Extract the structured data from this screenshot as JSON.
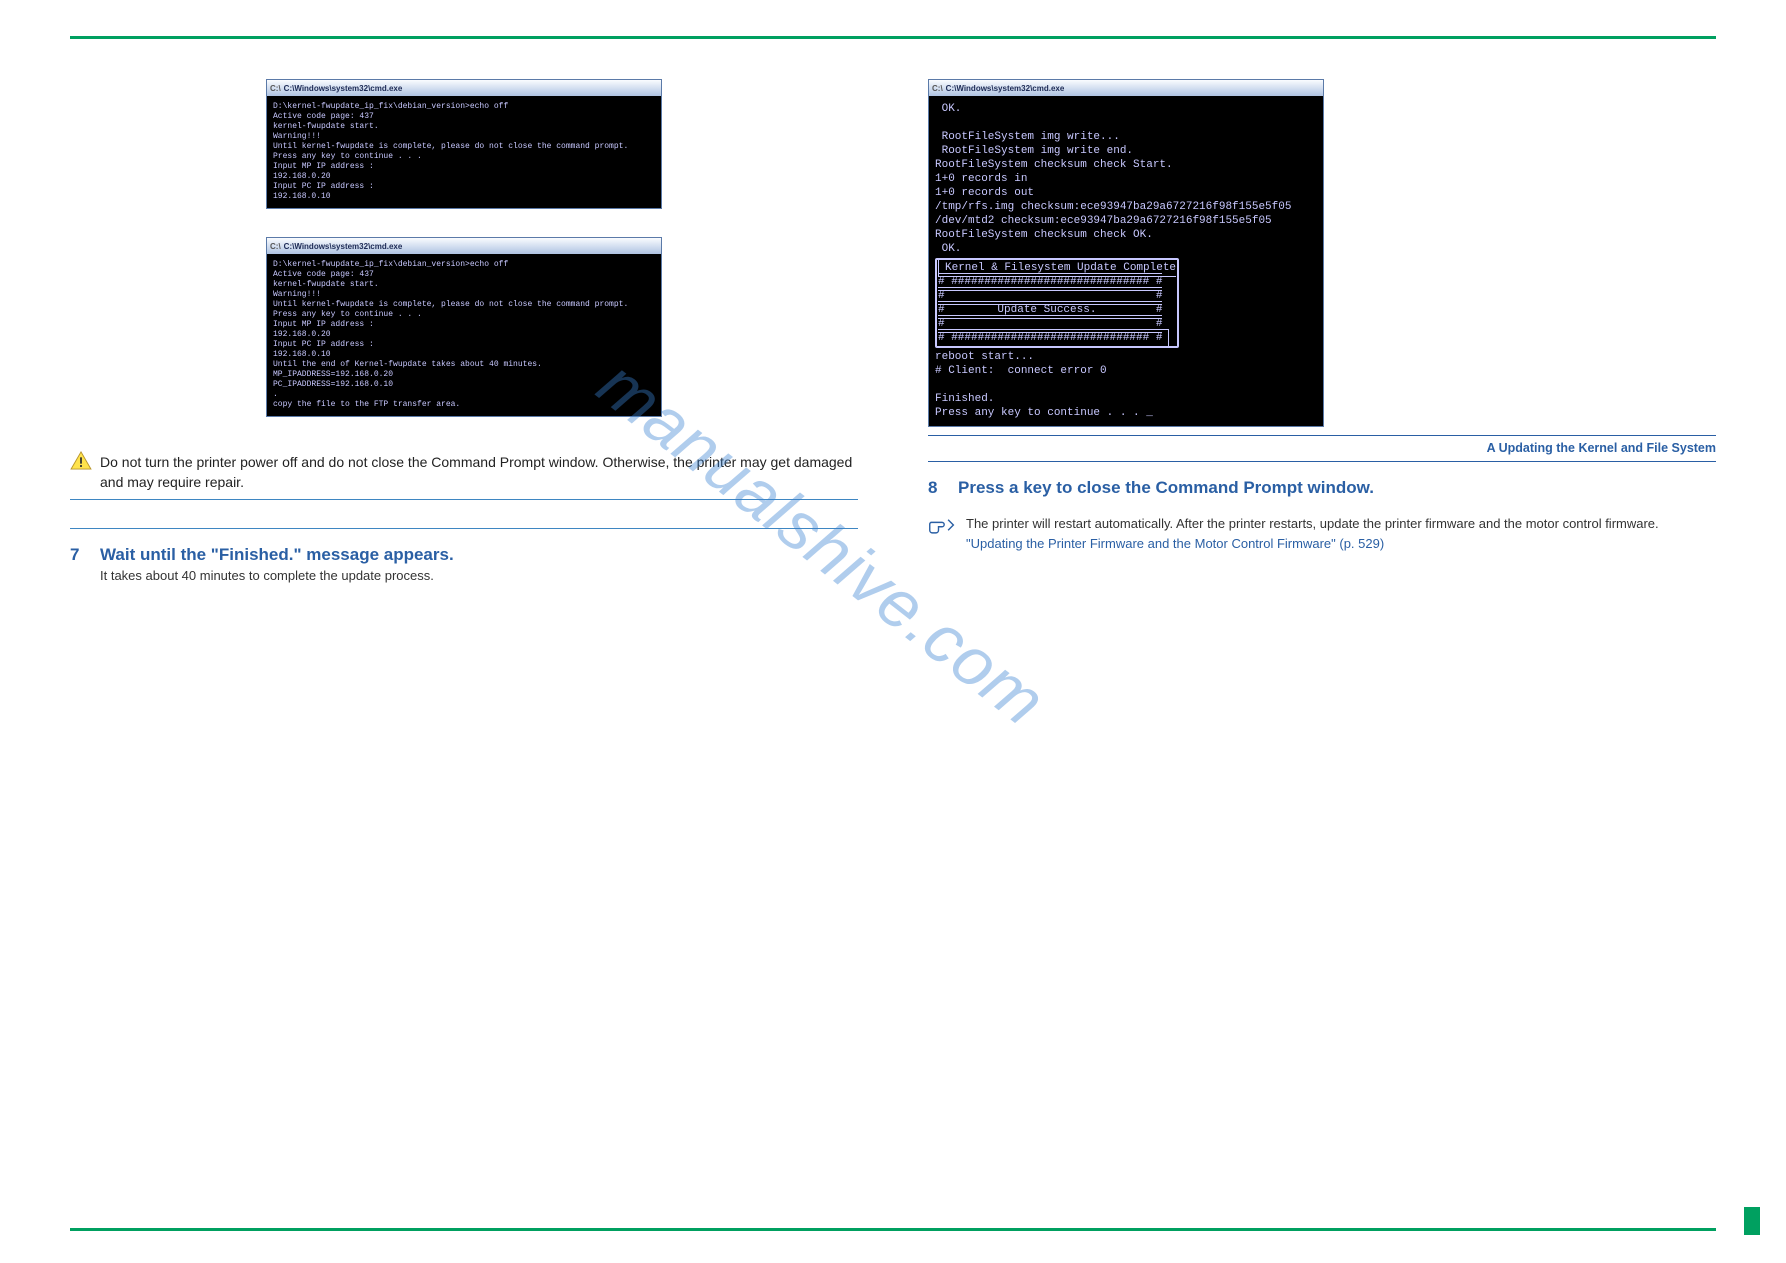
{
  "watermark": "manualshive.com",
  "cmd_title_prefix": "C:\\",
  "cmd_title": "C:\\Windows\\system32\\cmd.exe",
  "cmd1_body": "D:\\kernel-fwupdate_ip_fix\\debian_version>echo off\nActive code page: 437\nkernel-fwupdate start.\nWarning!!!\nUntil kernel-fwupdate is complete, please do not close the command prompt.\nPress any key to continue . . .\nInput MP IP address :\n192.168.0.20\nInput PC IP address :\n192.168.0.10",
  "cmd2_body": "D:\\kernel-fwupdate_ip_fix\\debian_version>echo off\nActive code page: 437\nkernel-fwupdate start.\nWarning!!!\nUntil kernel-fwupdate is complete, please do not close the command prompt.\nPress any key to continue . . .\nInput MP IP address :\n192.168.0.20\nInput PC IP address :\n192.168.0.10\nUntil the end of Kernel-fwupdate takes about 40 minutes.\nMP_IPADDRESS=192.168.0.20\nPC_IPADDRESS=192.168.0.10\n.\ncopy the file to the FTP transfer area.",
  "cmd3_body_pre": " OK.\n\n RootFileSystem img write...\n RootFileSystem img write end.\nRootFileSystem checksum check Start.\n1+0 records in\n1+0 records out\n/tmp/rfs.img checksum:ece93947ba29a6727216f98f155e5f05\n/dev/mtd2 checksum:ece93947ba29a6727216f98f155e5f05\nRootFileSystem checksum check OK.\n OK.",
  "cmd3_box1": "Kernel & Filesystem Update Complete",
  "cmd3_box2": "# ############################## #\n#                                #\n#        Update Success.         #\n#                                #\n# ############################## #",
  "cmd3_body_post": "\nreboot start...\n# Client:  connect error 0\n\nFinished.\nPress any key to continue . . . _",
  "warn_text": "Do not turn the printer power off and do not close the Command Prompt window. Otherwise, the printer may get damaged and may require repair.",
  "step7_num": "7",
  "step7_text": "Wait until the \"Finished.\" message appears.",
  "step7_sub": "It takes about 40 minutes to complete the update process.",
  "stepbar_title": "A  Updating the Kernel and File System",
  "step8_num": "8",
  "step8_text": "Press a key to close the Command Prompt window.",
  "hand_text": "The printer will restart automatically. After the printer restarts, update the printer firmware and the motor control firmware.",
  "hand_link": "\"Updating the Printer Firmware and the Motor Control Firmware\" (p. 529)"
}
